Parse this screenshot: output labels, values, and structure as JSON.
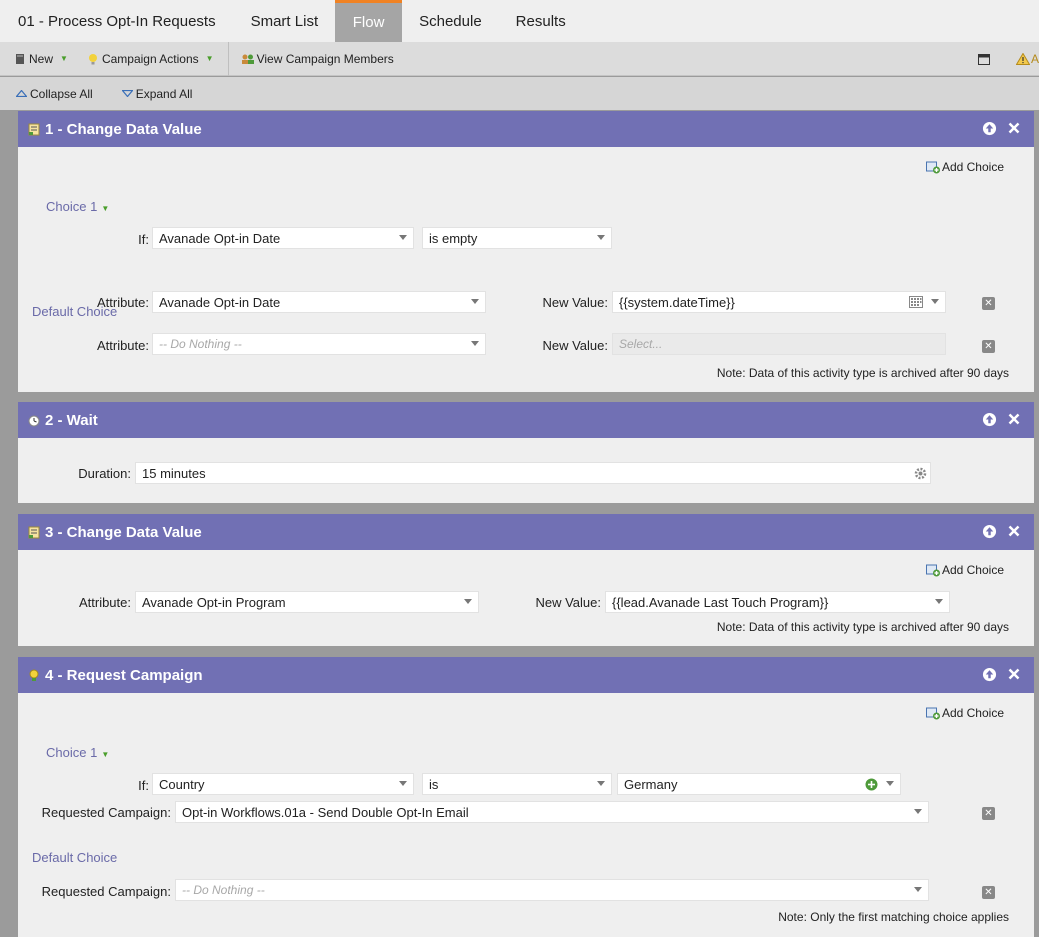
{
  "tabs": [
    {
      "label": "01 - Process Opt-In Requests"
    },
    {
      "label": "Smart List"
    },
    {
      "label": "Flow"
    },
    {
      "label": "Schedule"
    },
    {
      "label": "Results"
    }
  ],
  "toolbar": {
    "new_label": "New",
    "campaign_actions_label": "Campaign Actions",
    "view_members_label": "View Campaign Members",
    "right_warning_label": "A"
  },
  "collapse": {
    "collapse_all": "Collapse All",
    "expand_all": "Expand All"
  },
  "colors": {
    "header": "#7170b4",
    "active_tab_accent": "#f08223",
    "panel_bg": "#efefef"
  },
  "steps": [
    {
      "title": "1 - Change Data Value",
      "add_choice": "Add Choice",
      "choice_label": "Choice 1",
      "if_label": "If:",
      "if_attribute": "Avanade Opt-in Date",
      "if_operator": "is empty",
      "attribute_label": "Attribute:",
      "attribute_value": "Avanade Opt-in Date",
      "new_value_label": "New Value:",
      "new_value": "{{system.dateTime}}",
      "default_label": "Default Choice",
      "default_attribute_label": "Attribute:",
      "default_attribute": "-- Do Nothing --",
      "default_new_value_label": "New Value:",
      "default_new_value_placeholder": "Select...",
      "note": "Note: Data of this activity type is archived after 90 days"
    },
    {
      "title": "2 - Wait",
      "duration_label": "Duration:",
      "duration_value": "15 minutes"
    },
    {
      "title": "3 - Change Data Value",
      "add_choice": "Add Choice",
      "attribute_label": "Attribute:",
      "attribute_value": "Avanade Opt-in Program",
      "new_value_label": "New Value:",
      "new_value": "{{lead.Avanade Last Touch Program}}",
      "note": "Note: Data of this activity type is archived after 90 days"
    },
    {
      "title": "4 - Request Campaign",
      "add_choice": "Add Choice",
      "choice_label": "Choice 1",
      "if_label": "If:",
      "if_attribute": "Country",
      "if_operator": "is",
      "if_value": "Germany",
      "requested_label": "Requested Campaign:",
      "requested_value": "Opt-in Workflows.01a - Send Double Opt-In Email",
      "default_label": "Default Choice",
      "default_requested_label": "Requested Campaign:",
      "default_requested_value": "-- Do Nothing --",
      "note": "Note: Only the first matching choice applies"
    }
  ]
}
